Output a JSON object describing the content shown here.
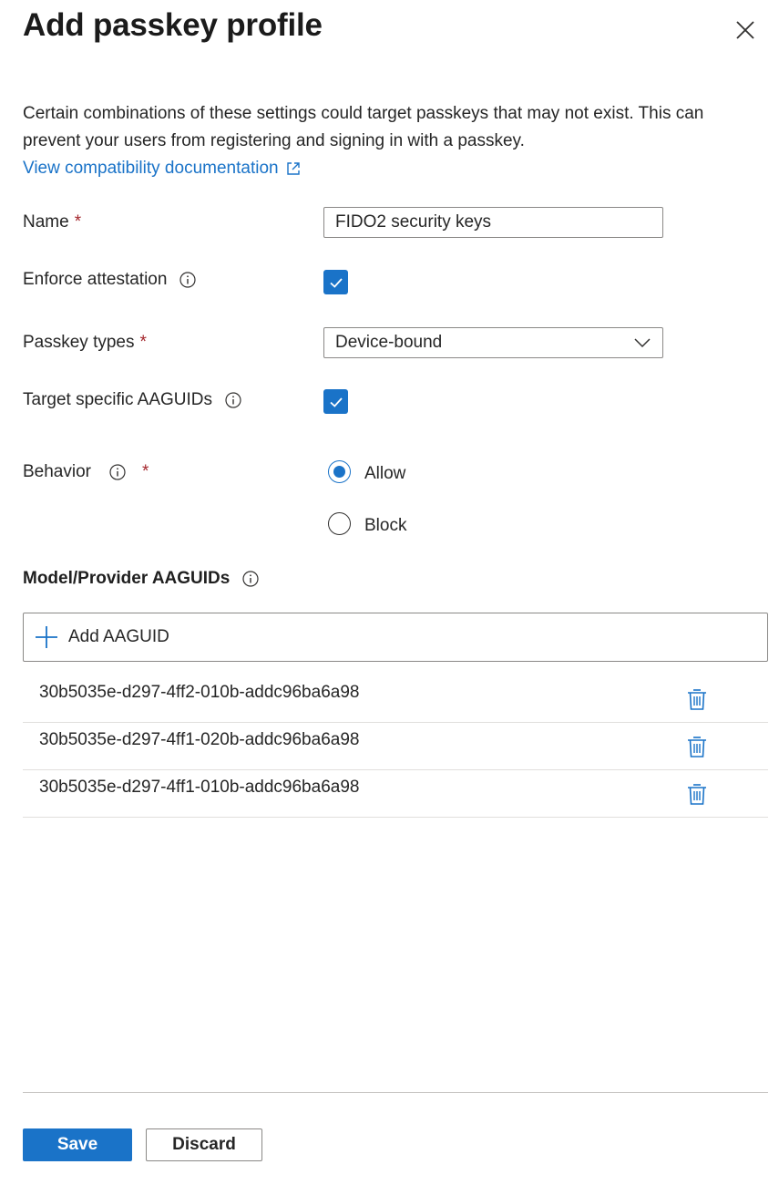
{
  "panel": {
    "title": "Add passkey profile",
    "close_icon": "close-icon"
  },
  "notice": {
    "text_line1": "Certain combinations of these settings could target passkeys that may not exist. This can",
    "text_line2": "prevent your users from registering and signing in with a passkey.",
    "link_label": "View compatibility documentation",
    "link_icon": "external-link-icon"
  },
  "form": {
    "name": {
      "label": "Name",
      "required_mark": "*",
      "value": "FIDO2 security keys"
    },
    "enforce_attestation": {
      "label": "Enforce attestation",
      "checked": true
    },
    "passkey_types": {
      "label": "Passkey types",
      "required_mark": "*",
      "selected": "Device-bound"
    },
    "target_aaguids": {
      "label": "Target specific AAGUIDs",
      "checked": true
    },
    "behavior": {
      "label": "Behavior",
      "required_mark": "*",
      "options": [
        {
          "label": "Allow",
          "selected": true
        },
        {
          "label": "Block",
          "selected": false
        }
      ]
    }
  },
  "aaguids": {
    "heading": "Model/Provider AAGUIDs",
    "add_label": "Add AAGUID",
    "items": [
      "30b5035e-d297-4ff2-010b-addc96ba6a98",
      "30b5035e-d297-4ff1-020b-addc96ba6a98",
      "30b5035e-d297-4ff1-010b-addc96ba6a98"
    ]
  },
  "footer": {
    "save_label": "Save",
    "discard_label": "Discard"
  },
  "colors": {
    "accent": "#1a73c8",
    "required": "#a4262c"
  }
}
